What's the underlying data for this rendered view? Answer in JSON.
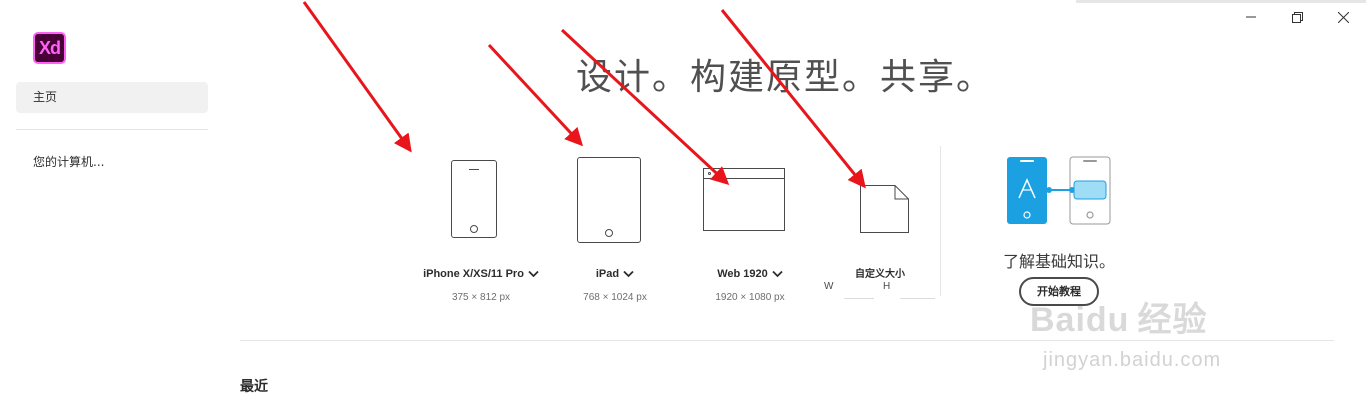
{
  "window": {
    "controls": [
      "minimize",
      "restore",
      "close"
    ]
  },
  "app": {
    "logo_text": "Xd",
    "brand_color": "#ff61f6"
  },
  "sidebar": {
    "home_label": "主页",
    "computer_label": "您的计算机..."
  },
  "hero": {
    "title": "设计。构建原型。共享。"
  },
  "presets": [
    {
      "label": "iPhone X/XS/11 Pro",
      "size": "375 × 812 px",
      "icon": "phone-icon"
    },
    {
      "label": "iPad",
      "size": "768 × 1024 px",
      "icon": "tablet-icon"
    },
    {
      "label": "Web 1920",
      "size": "1920 × 1080 px",
      "icon": "browser-icon"
    },
    {
      "label": "自定义大小",
      "w_label": "W",
      "h_label": "H",
      "icon": "document-icon"
    }
  ],
  "learn": {
    "title": "了解基础知识。",
    "button": "开始教程",
    "accent": "#1ba1e2"
  },
  "recent": {
    "label": "最近"
  },
  "watermark": {
    "logo": "Baidu",
    "logo_cn": "经验",
    "url": "jingyan.baidu.com"
  },
  "annotation_color": "#e8161c"
}
